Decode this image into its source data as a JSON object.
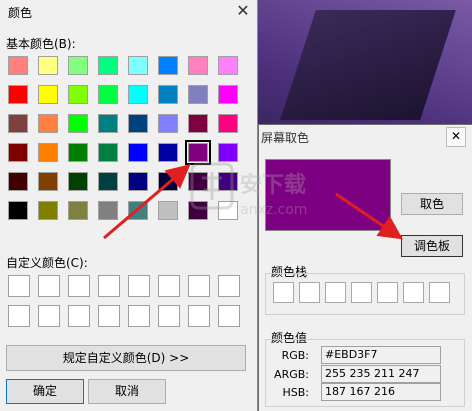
{
  "dialog": {
    "title": "颜色",
    "basic_colors_label": "基本颜色(B):",
    "custom_colors_label": "自定义颜色(C):",
    "define_custom_button": "规定自定义颜色(D) >>",
    "ok_button": "确定",
    "cancel_button": "取消",
    "close_icon": "close-icon",
    "basic_colors": [
      [
        "#ff8080",
        "#ffff80",
        "#80ff80",
        "#00ff80",
        "#80ffff",
        "#0080ff",
        "#ff80c0",
        "#ff80ff"
      ],
      [
        "#ff0000",
        "#ffff00",
        "#80ff00",
        "#00ff40",
        "#00ffff",
        "#0080c0",
        "#8080c0",
        "#ff00ff"
      ],
      [
        "#804040",
        "#ff8040",
        "#00ff00",
        "#008080",
        "#004080",
        "#8080ff",
        "#800040",
        "#ff0080"
      ],
      [
        "#800000",
        "#ff8000",
        "#008000",
        "#008040",
        "#0000ff",
        "#0000a0",
        "#800080",
        "#8000ff"
      ],
      [
        "#400000",
        "#804000",
        "#004000",
        "#004040",
        "#000080",
        "#000040",
        "#400040",
        "#400080"
      ],
      [
        "#000000",
        "#808000",
        "#808040",
        "#808080",
        "#408080",
        "#c0c0c0",
        "#400040",
        "#ffffff"
      ]
    ],
    "selected_color_index": [
      3,
      6
    ]
  },
  "picker": {
    "title": "屏幕取色",
    "pick_button": "取色",
    "palette_button": "调色板",
    "history_label": "颜色栈",
    "values_label": "颜色值",
    "close_icon": "close-icon",
    "preview_color": "#7e0082",
    "rows": [
      {
        "key": "RGB:",
        "value": "#EBD3F7"
      },
      {
        "key": "ARGB:",
        "value": "255 235 211 247"
      },
      {
        "key": "HSB:",
        "value": "187 167 216"
      }
    ]
  },
  "watermark": "anxz.com"
}
